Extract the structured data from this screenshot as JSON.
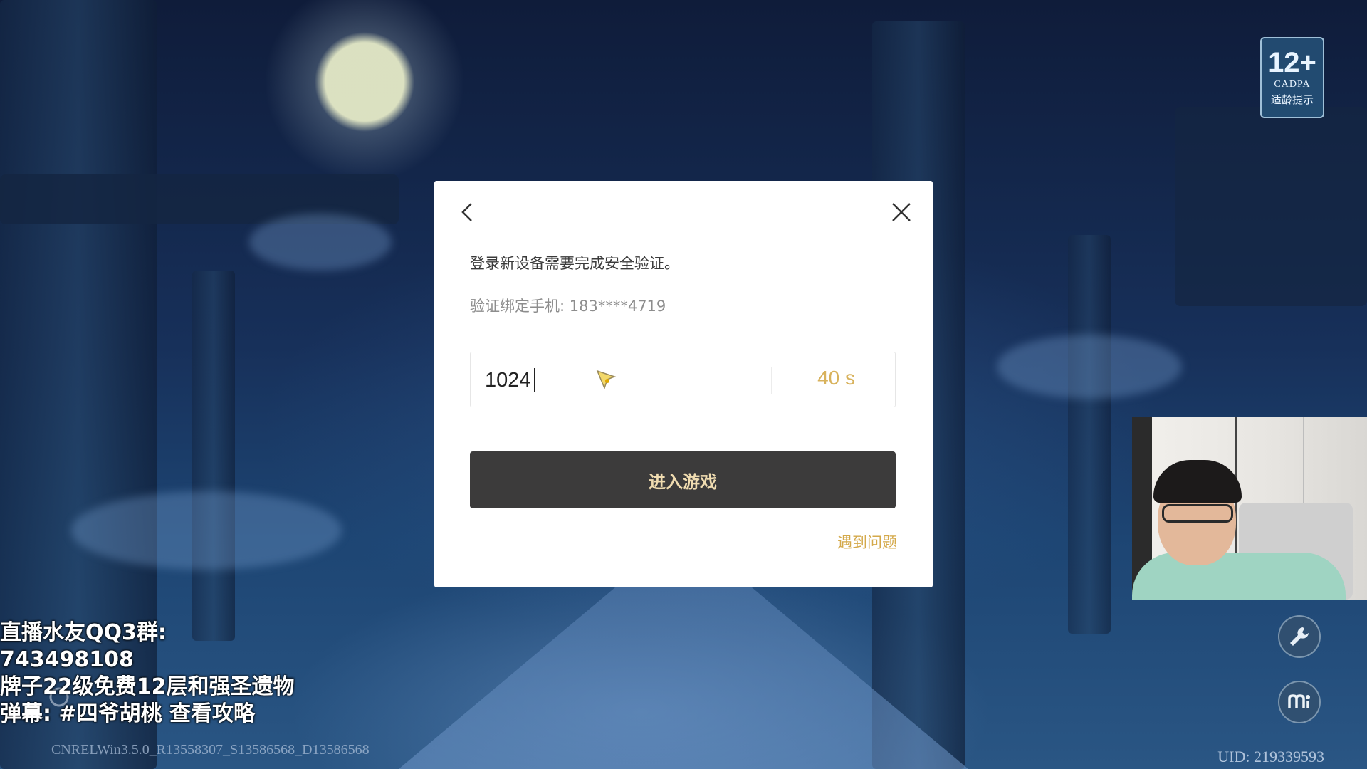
{
  "age_rating": {
    "number": "12+",
    "org": "CADPA",
    "tip": "适龄提示"
  },
  "dialog": {
    "message": "登录新设备需要完成安全验证。",
    "phone_label": "验证绑定手机: 183****4719",
    "code_value": "1024",
    "timer": "40 s",
    "enter_button": "进入游戏",
    "help_link": "遇到问题",
    "colors": {
      "accent": "#d4a94a",
      "button_bg": "#3c3b3b",
      "button_text": "#f0dcb0"
    }
  },
  "overlay": {
    "line1": "直播水友QQ3群:",
    "line2": "743498108",
    "line3": "牌子22级免费12层和强圣遗物",
    "line4": "弹幕: #四爷胡桃 查看攻略"
  },
  "footer": {
    "version": "CNRELWin3.5.0_R13558307_S13586568_D13586568",
    "uid": "UID: 219339593"
  },
  "icons": [
    "back-arrow-icon",
    "close-icon",
    "mouse-cursor-icon",
    "wrench-icon",
    "mi-logo-icon",
    "refresh-icon"
  ]
}
